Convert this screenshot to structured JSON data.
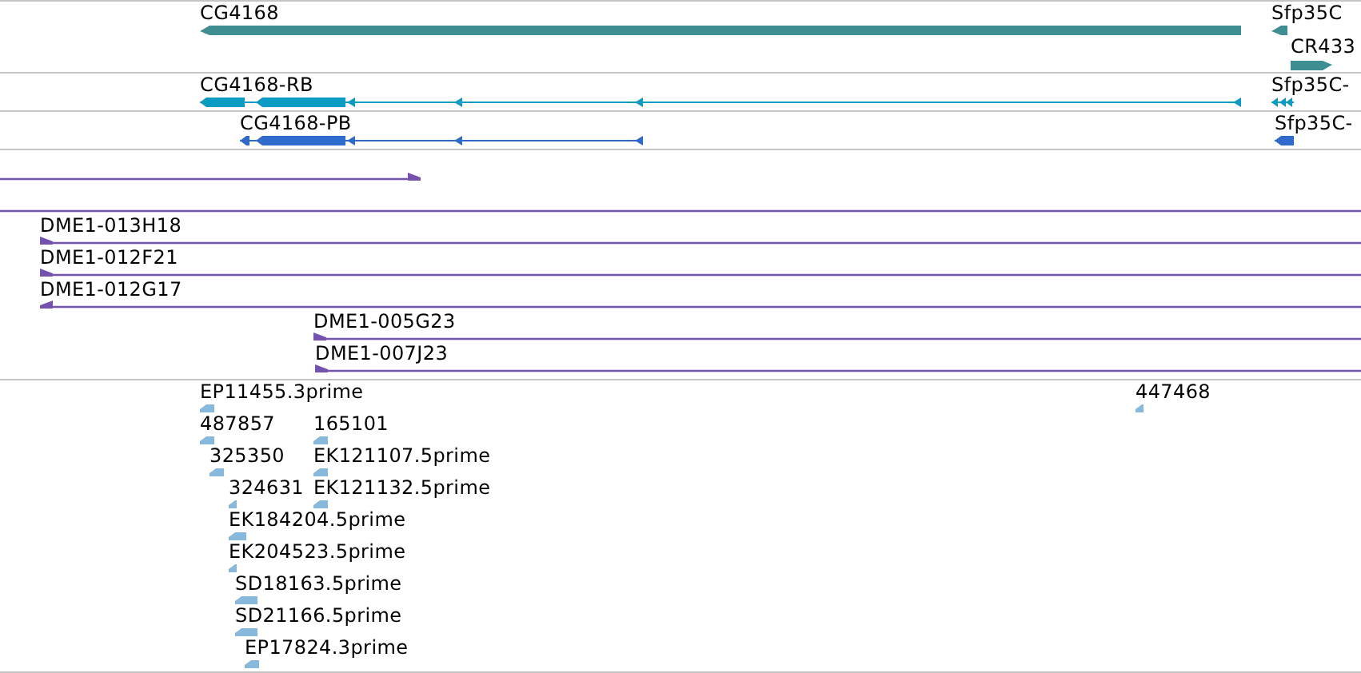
{
  "tracks": [
    {
      "features": [
        {
          "label": "CG4168",
          "kind": "gene",
          "reverse": true
        },
        {
          "label": "Sfp35C",
          "kind": "gene",
          "reverse": true
        },
        {
          "label": "CR433",
          "kind": "gene",
          "reverse": false
        }
      ]
    },
    {
      "features": [
        {
          "label": "CG4168-RB",
          "kind": "transcript",
          "reverse": true
        },
        {
          "label": "Sfp35C-",
          "kind": "transcript",
          "reverse": true
        }
      ]
    },
    {
      "features": [
        {
          "label": "CG4168-PB",
          "kind": "protein",
          "reverse": true
        },
        {
          "label": "Sfp35C-",
          "kind": "protein",
          "reverse": true
        }
      ]
    },
    {
      "features": [
        {
          "kind": "clone",
          "reverse": false
        },
        {
          "kind": "clone"
        },
        {
          "label": "DME1-013H18",
          "kind": "clone",
          "reverse": false
        },
        {
          "label": "DME1-012F21",
          "kind": "clone",
          "reverse": false
        },
        {
          "label": "DME1-012G17",
          "kind": "clone",
          "reverse": true
        },
        {
          "label": "DME1-005G23",
          "kind": "clone",
          "reverse": false
        },
        {
          "label": "DME1-007J23",
          "kind": "clone",
          "reverse": false
        }
      ]
    },
    {
      "features": [
        {
          "label": "EP11455.3prime",
          "kind": "est",
          "reverse": true
        },
        {
          "label": "447468",
          "kind": "est",
          "reverse": true
        },
        {
          "label": "487857",
          "kind": "est",
          "reverse": true
        },
        {
          "label": "165101",
          "kind": "est",
          "reverse": true
        },
        {
          "label": "325350",
          "kind": "est",
          "reverse": true
        },
        {
          "label": "EK121107.5prime",
          "kind": "est",
          "reverse": true
        },
        {
          "label": "324631",
          "kind": "est",
          "reverse": true
        },
        {
          "label": "EK121132.5prime",
          "kind": "est",
          "reverse": true
        },
        {
          "label": "EK184204.5prime",
          "kind": "est",
          "reverse": true
        },
        {
          "label": "EK204523.5prime",
          "kind": "est",
          "reverse": true
        },
        {
          "label": "SD18163.5prime",
          "kind": "est",
          "reverse": true
        },
        {
          "label": "SD21166.5prime",
          "kind": "est",
          "reverse": true
        },
        {
          "label": "EP17824.3prime",
          "kind": "est",
          "reverse": true
        }
      ]
    }
  ]
}
